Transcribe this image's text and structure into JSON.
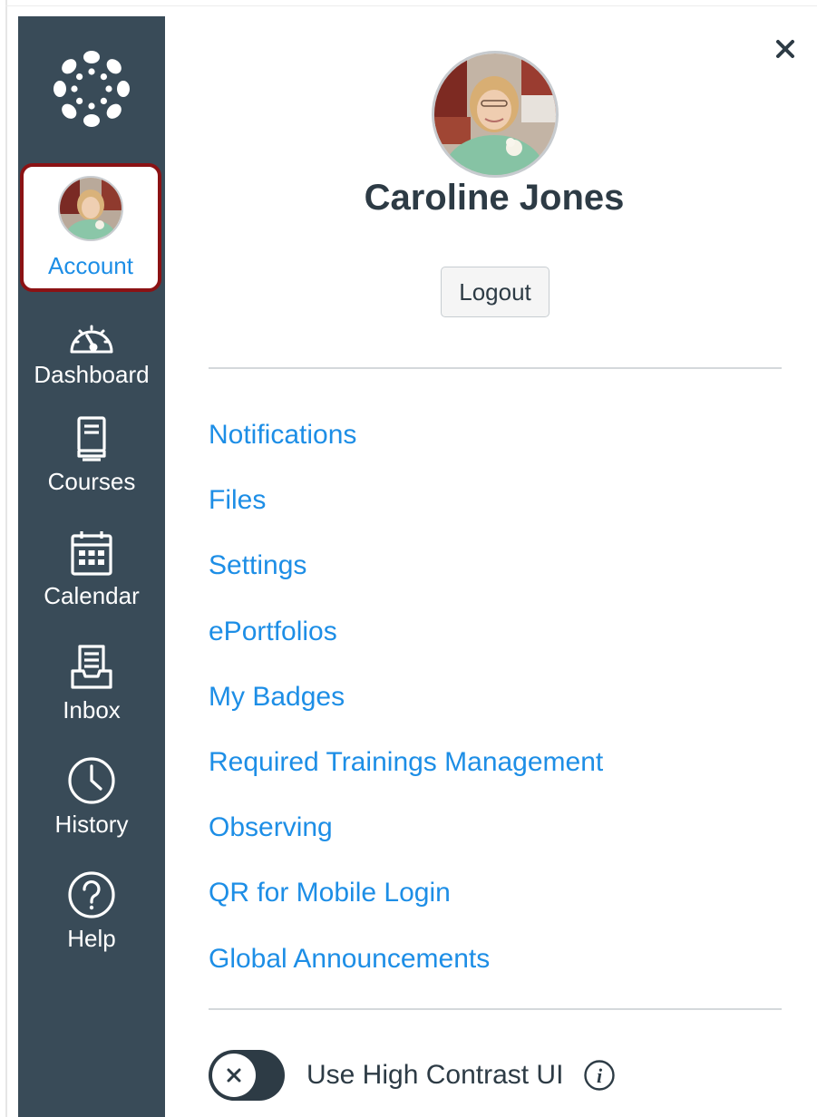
{
  "nav": {
    "account_label": "Account",
    "items": [
      {
        "label": "Dashboard",
        "icon": "dashboard-gauge-icon"
      },
      {
        "label": "Courses",
        "icon": "courses-book-icon"
      },
      {
        "label": "Calendar",
        "icon": "calendar-icon"
      },
      {
        "label": "Inbox",
        "icon": "inbox-tray-icon"
      },
      {
        "label": "History",
        "icon": "clock-icon"
      },
      {
        "label": "Help",
        "icon": "help-question-icon"
      }
    ]
  },
  "tray": {
    "user_name": "Caroline Jones",
    "logout_label": "Logout",
    "links": [
      "Notifications",
      "Files",
      "Settings",
      "ePortfolios",
      "My Badges",
      "Required Trainings Management",
      "Observing",
      "QR for Mobile Login",
      "Global Announcements"
    ],
    "high_contrast_label": "Use High Contrast UI",
    "high_contrast_enabled": false
  },
  "colors": {
    "nav_background": "#394b58",
    "link_blue": "#1d8ee6",
    "account_highlight_border": "#8b1214",
    "text_dark": "#2d3b45"
  }
}
